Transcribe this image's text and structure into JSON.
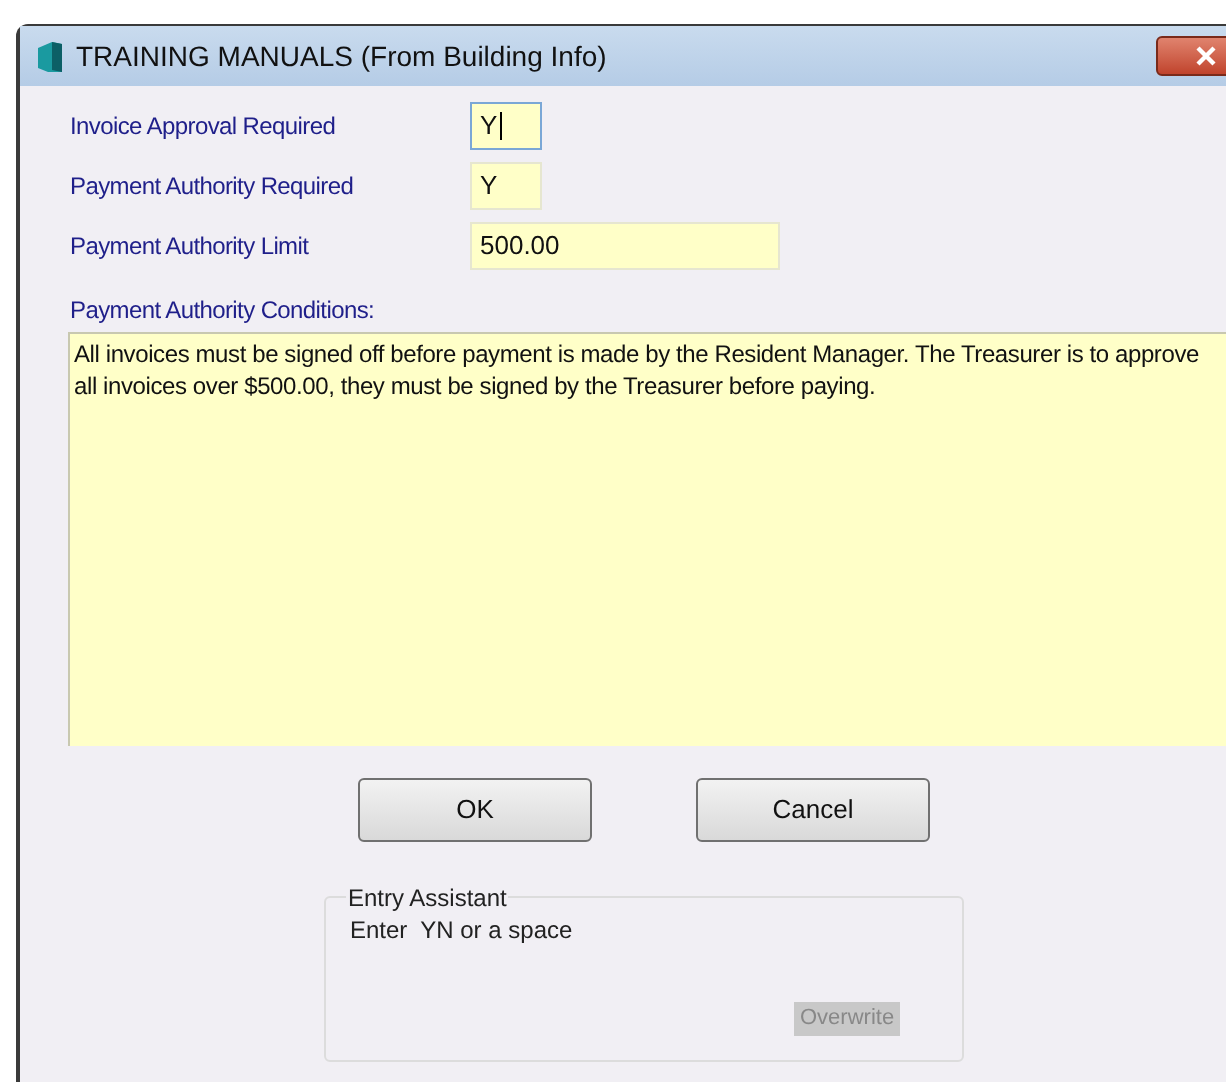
{
  "window": {
    "title": "TRAINING MANUALS (From Building Info)"
  },
  "fields": [
    {
      "label": "Invoice Approval Required",
      "value": "Y",
      "kind": "short",
      "focused": true
    },
    {
      "label": "Payment Authority Required",
      "value": "Y",
      "kind": "short",
      "focused": false
    },
    {
      "label": "Payment Authority Limit",
      "value": "500.00",
      "kind": "long",
      "focused": false
    }
  ],
  "conditions": {
    "label": "Payment Authority Conditions:",
    "value": "All invoices must be signed off before payment is made by the Resident Manager. The Treasurer is to approve all invoices over $500.00, they must be signed by the Treasurer before paying."
  },
  "buttons": [
    "OK",
    "Cancel"
  ],
  "entry_assistant": {
    "title": "Entry Assistant",
    "hint": "Enter  YN or a space",
    "mode": "Overwrite"
  }
}
